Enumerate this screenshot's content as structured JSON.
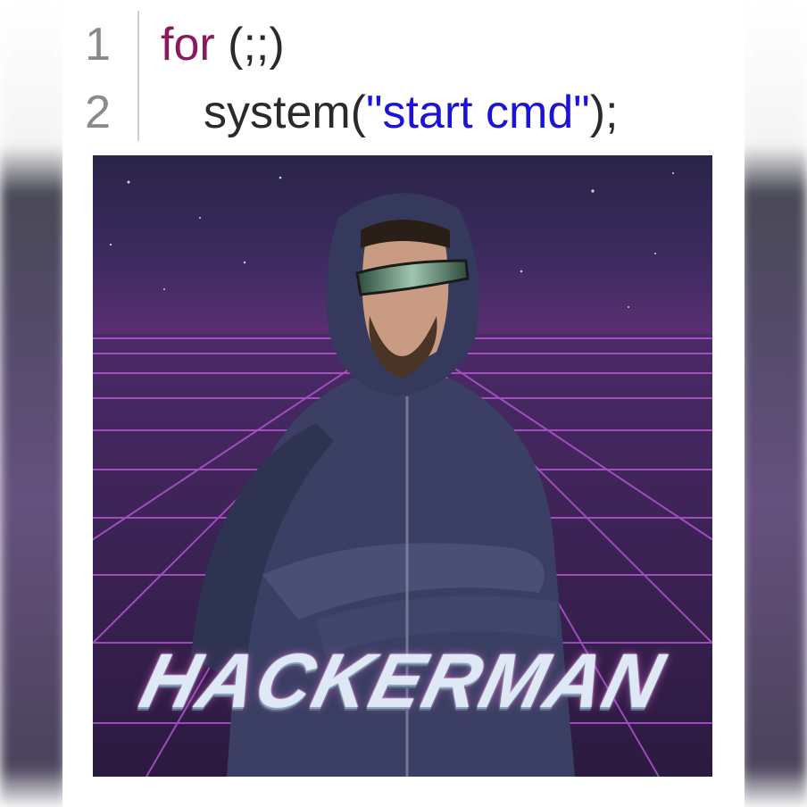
{
  "code": {
    "lines": [
      {
        "number": "1",
        "keyword": "for",
        "rest": " (;;)"
      },
      {
        "number": "2",
        "prefix": "system(",
        "string": "\"start cmd\"",
        "suffix": ");"
      }
    ]
  },
  "meme": {
    "caption": "HACKERMAN"
  },
  "colors": {
    "keyword": "#8b1a5c",
    "string": "#1b13d6",
    "line_number": "#8a8a8a",
    "grid": "#c35be0",
    "sky": "#2a1d4a"
  }
}
